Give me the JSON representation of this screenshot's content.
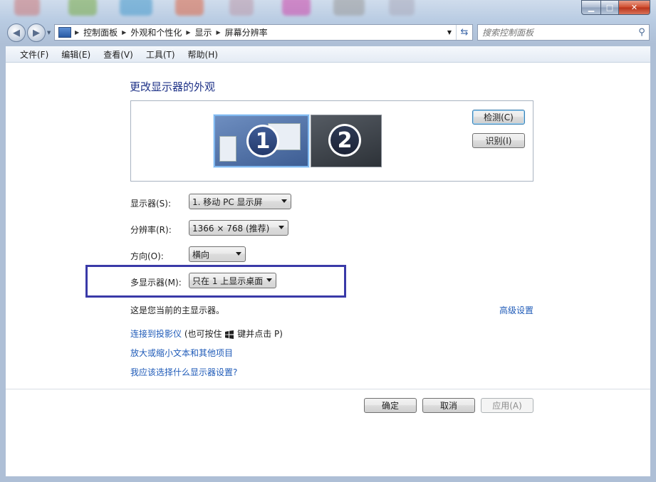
{
  "window": {
    "caption_buttons": {
      "minimize": "▁",
      "maximize": "□",
      "close": "✕"
    }
  },
  "nav": {
    "back_icon": "back-arrow-icon",
    "forward_icon": "forward-arrow-icon",
    "breadcrumbs": [
      "控制面板",
      "外观和个性化",
      "显示",
      "屏幕分辨率"
    ],
    "search_placeholder": "搜索控制面板"
  },
  "menubar": {
    "items": [
      "文件(F)",
      "编辑(E)",
      "查看(V)",
      "工具(T)",
      "帮助(H)"
    ]
  },
  "main": {
    "heading": "更改显示器的外观",
    "monitors": [
      {
        "number": "1",
        "selected": true
      },
      {
        "number": "2",
        "selected": false
      }
    ],
    "detect_button": "检测(C)",
    "identify_button": "识别(I)",
    "display_label": "显示器(S):",
    "display_value": "1. 移动 PC 显示屏",
    "resolution_label": "分辨率(R):",
    "resolution_value": "1366 × 768 (推荐)",
    "orientation_label": "方向(O):",
    "orientation_value": "横向",
    "multi_label": "多显示器(M):",
    "multi_value": "只在 1 上显示桌面",
    "primary_text": "这是您当前的主显示器。",
    "advanced_link": "高级设置",
    "projector_link": "连接到投影仪",
    "projector_hint_a": "(也可按住",
    "projector_hint_b": "键并点击 P)",
    "text_size_link": "放大或缩小文本和其他项目",
    "which_settings_link": "我应该选择什么显示器设置?"
  },
  "footer": {
    "ok": "确定",
    "cancel": "取消",
    "apply": "应用(A)"
  },
  "colors": {
    "link": "#1f5bb8",
    "heading": "#1e3287",
    "highlight_box": "#3a3aa8"
  }
}
